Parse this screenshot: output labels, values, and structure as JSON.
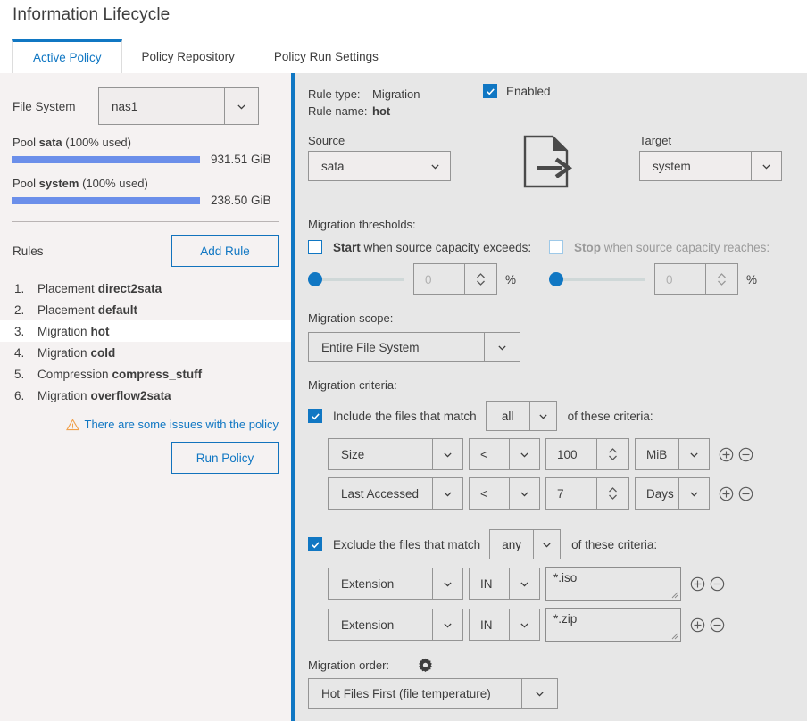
{
  "header": {
    "title": "Information Lifecycle"
  },
  "tabs": [
    {
      "label": "Active Policy",
      "active": true
    },
    {
      "label": "Policy Repository",
      "active": false
    },
    {
      "label": "Policy Run Settings",
      "active": false
    }
  ],
  "left": {
    "file_system": {
      "label": "File System",
      "value": "nas1"
    },
    "pools": [
      {
        "name": "sata",
        "prefix": "Pool ",
        "suffix": " (100% used)",
        "percent": 100,
        "size": "931.51 GiB"
      },
      {
        "name": "system",
        "prefix": "Pool ",
        "suffix": " (100% used)",
        "percent": 100,
        "size": "238.50 GiB"
      }
    ],
    "rules_title": "Rules",
    "add_rule_label": "Add Rule",
    "rules": [
      {
        "num": "1.",
        "type": "Placement",
        "name": "direct2sata",
        "selected": false
      },
      {
        "num": "2.",
        "type": "Placement",
        "name": "default",
        "selected": false
      },
      {
        "num": "3.",
        "type": "Migration",
        "name": "hot",
        "selected": true
      },
      {
        "num": "4.",
        "type": "Migration",
        "name": "cold",
        "selected": false
      },
      {
        "num": "5.",
        "type": "Compression",
        "name": "compress_stuff",
        "selected": false
      },
      {
        "num": "6.",
        "type": "Migration",
        "name": "overflow2sata",
        "selected": false
      }
    ],
    "issues_text": "There are some issues with the policy",
    "run_policy_label": "Run Policy"
  },
  "right": {
    "rule_type_label": "Rule type:",
    "rule_type_value": "Migration",
    "rule_name_label": "Rule name:",
    "rule_name_value": "hot",
    "enabled_label": "Enabled",
    "enabled_checked": true,
    "source_label": "Source",
    "source_value": "sata",
    "target_label": "Target",
    "target_value": "system",
    "thresholds_label": "Migration thresholds:",
    "start": {
      "checked": false,
      "strong": "Start",
      "rest": " when source capacity exceeds:",
      "value": "0",
      "placeholder": "0",
      "unit": "%",
      "slider_percent": 0
    },
    "stop": {
      "checked": false,
      "disabled": true,
      "strong": "Stop",
      "rest": " when source capacity reaches:",
      "value": "0",
      "placeholder": "0",
      "unit": "%",
      "slider_percent": 0
    },
    "scope_label": "Migration scope:",
    "scope_value": "Entire File System",
    "criteria_label": "Migration criteria:",
    "include": {
      "checked": true,
      "prefix": "Include the files that match",
      "match": "all",
      "suffix": "of these criteria:",
      "rows": [
        {
          "field": "Size",
          "op": "<",
          "value": "100",
          "unit": "MiB"
        },
        {
          "field": "Last Accessed",
          "op": "<",
          "value": "7",
          "unit": "Days"
        }
      ]
    },
    "exclude": {
      "checked": true,
      "prefix": "Exclude the files that match",
      "match": "any",
      "suffix": "of these criteria:",
      "rows": [
        {
          "field": "Extension",
          "op": "IN",
          "value": "*.iso"
        },
        {
          "field": "Extension",
          "op": "IN",
          "value": "*.zip"
        }
      ]
    },
    "order_label": "Migration order:",
    "order_value": "Hot Files First (file temperature)"
  },
  "colors": {
    "accent_blue": "#1077c3",
    "bar_blue": "#6b8fea",
    "warning_orange": "#f0a04b",
    "left_bg": "#f5f2f2",
    "right_bg": "#e7e7e7"
  }
}
